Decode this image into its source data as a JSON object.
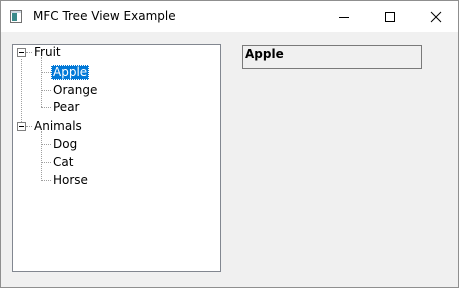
{
  "window": {
    "title": "MFC Tree View Example"
  },
  "tree": {
    "nodes": [
      {
        "label": "Fruit",
        "expanded": true,
        "children": [
          {
            "label": "Apple",
            "selected": true
          },
          {
            "label": "Orange"
          },
          {
            "label": "Pear"
          }
        ]
      },
      {
        "label": "Animals",
        "expanded": true,
        "children": [
          {
            "label": "Dog"
          },
          {
            "label": "Cat"
          },
          {
            "label": "Horse"
          }
        ]
      }
    ]
  },
  "selection_display": {
    "text": "Apple"
  },
  "icons": {
    "app": "app-icon",
    "minimize": "minimize-icon",
    "maximize": "maximize-icon",
    "close": "close-icon",
    "collapse": "collapse-icon"
  },
  "colors": {
    "selection_bg": "#0078d7",
    "selection_fg": "#ffffff"
  }
}
